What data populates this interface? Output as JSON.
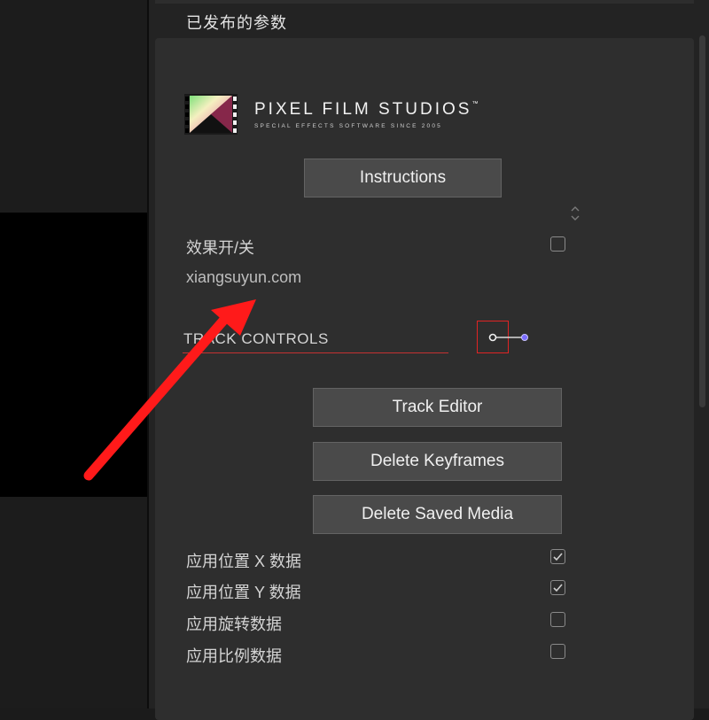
{
  "inspector": {
    "section_title": "已发布的参数"
  },
  "logo": {
    "title": "PIXEL FILM STUDIOS",
    "trademark": "™",
    "tagline": "SPECIAL EFFECTS SOFTWARE SINCE 2005"
  },
  "buttons": {
    "instructions": "Instructions",
    "track_editor": "Track Editor",
    "delete_keyframes": "Delete Keyframes",
    "delete_saved_media": "Delete Saved Media"
  },
  "effect_toggle": {
    "label": "效果开/关",
    "checked": false
  },
  "watermark_text": "xiangsuyun.com",
  "track_controls": {
    "label": "TRACK CONTROLS"
  },
  "options": [
    {
      "label": "应用位置 X 数据",
      "checked": true
    },
    {
      "label": "应用位置 Y 数据",
      "checked": true
    },
    {
      "label": "应用旋转数据",
      "checked": false
    },
    {
      "label": "应用比例数据",
      "checked": false
    }
  ],
  "colors": {
    "annotation_arrow": "#ff1a1a",
    "highlight_box": "#e02424",
    "point_end": "#7a6cff"
  },
  "icons": {
    "logo": "film-strip-logo-icon",
    "sort": "sort-chevrons-icon",
    "check": "checkmark-icon",
    "point_control": "point-control-icon",
    "annotation": "red-arrow-annotation"
  }
}
